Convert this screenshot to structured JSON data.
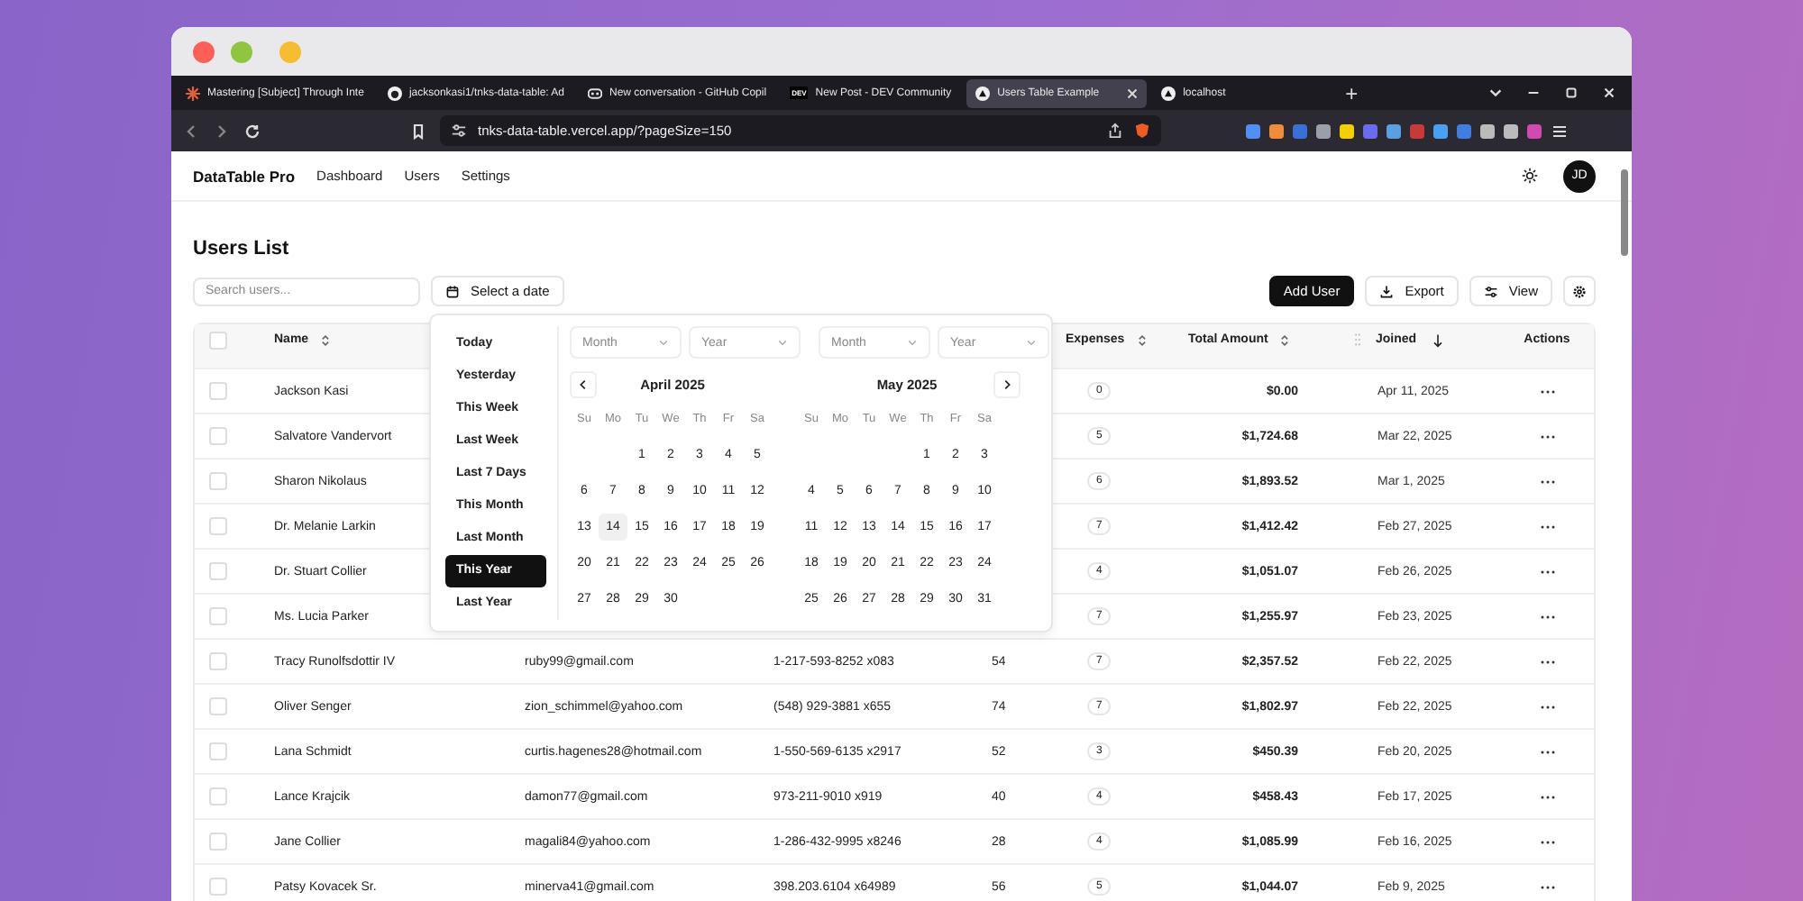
{
  "browser": {
    "tabs": [
      {
        "title": "Mastering [Subject] Through Inte",
        "selected": false,
        "kind": "spark"
      },
      {
        "title": "jacksonkasi1/tnks-data-table: Ad",
        "selected": false,
        "kind": "github"
      },
      {
        "title": "New conversation - GitHub Copil",
        "selected": false,
        "kind": "copilot"
      },
      {
        "title": "New Post - DEV Community",
        "selected": false,
        "kind": "dev"
      },
      {
        "title": "Users Table Example",
        "selected": true,
        "kind": "triangle"
      },
      {
        "title": "localhost",
        "selected": false,
        "kind": "triangle"
      }
    ],
    "new_tab": "+",
    "dev_label": "DEV",
    "address": "tnks-data-table.vercel.app/?pageSize=150"
  },
  "nav": {
    "brand": "DataTable Pro",
    "links": [
      "Dashboard",
      "Users",
      "Settings"
    ],
    "avatar": "JD"
  },
  "page_title": "Users List",
  "toolbar": {
    "search": {
      "placeholder": "Search users..."
    },
    "date_button": "Select a date",
    "add_button": "Add User",
    "export_button": "Export",
    "view_button": "View"
  },
  "date_picker": {
    "presets": [
      {
        "label": "Today",
        "selected": false
      },
      {
        "label": "Yesterday",
        "selected": false
      },
      {
        "label": "This Week",
        "selected": false
      },
      {
        "label": "Last Week",
        "selected": false
      },
      {
        "label": "Last 7 Days",
        "selected": false
      },
      {
        "label": "This Month",
        "selected": false
      },
      {
        "label": "Last Month",
        "selected": false
      },
      {
        "label": "This Year",
        "selected": true
      },
      {
        "label": "Last Year",
        "selected": false
      }
    ],
    "selects": [
      {
        "placeholder": "Month"
      },
      {
        "placeholder": "Year"
      },
      {
        "placeholder": "Month"
      },
      {
        "placeholder": "Year"
      }
    ],
    "calendars": [
      {
        "title": "April 2025",
        "weekdays": [
          "Su",
          "Mo",
          "Tu",
          "We",
          "Th",
          "Fr",
          "Sa"
        ],
        "weeks": [
          [
            {
              "day": "1",
              "today": false
            },
            {
              "day": "2",
              "today": false
            },
            {
              "day": "3",
              "today": false
            },
            {
              "day": "4",
              "today": false
            },
            {
              "day": "5",
              "today": false
            }
          ],
          [
            {
              "day": "6",
              "today": false
            },
            {
              "day": "7",
              "today": false
            },
            {
              "day": "8",
              "today": false
            },
            {
              "day": "9",
              "today": false
            },
            {
              "day": "10",
              "today": false
            },
            {
              "day": "11",
              "today": false
            },
            {
              "day": "12",
              "today": false
            }
          ],
          [
            {
              "day": "13",
              "today": false
            },
            {
              "day": "14",
              "today": true
            },
            {
              "day": "15",
              "today": false
            },
            {
              "day": "16",
              "today": false
            },
            {
              "day": "17",
              "today": false
            },
            {
              "day": "18",
              "today": false
            },
            {
              "day": "19",
              "today": false
            }
          ],
          [
            {
              "day": "20",
              "today": false
            },
            {
              "day": "21",
              "today": false
            },
            {
              "day": "22",
              "today": false
            },
            {
              "day": "23",
              "today": false
            },
            {
              "day": "24",
              "today": false
            },
            {
              "day": "25",
              "today": false
            },
            {
              "day": "26",
              "today": false
            }
          ],
          [
            {
              "day": "27",
              "today": false
            },
            {
              "day": "28",
              "today": false
            },
            {
              "day": "29",
              "today": false
            },
            {
              "day": "30",
              "today": false
            }
          ]
        ]
      },
      {
        "title": "May 2025",
        "weekdays": [
          "Su",
          "Mo",
          "Tu",
          "We",
          "Th",
          "Fr",
          "Sa"
        ],
        "weeks": [
          [
            {
              "day": "1",
              "today": false
            },
            {
              "day": "2",
              "today": false
            },
            {
              "day": "3",
              "today": false
            }
          ],
          [
            {
              "day": "4",
              "today": false
            },
            {
              "day": "5",
              "today": false
            },
            {
              "day": "6",
              "today": false
            },
            {
              "day": "7",
              "today": false
            },
            {
              "day": "8",
              "today": false
            },
            {
              "day": "9",
              "today": false
            },
            {
              "day": "10",
              "today": false
            }
          ],
          [
            {
              "day": "11",
              "today": false
            },
            {
              "day": "12",
              "today": false
            },
            {
              "day": "13",
              "today": false
            },
            {
              "day": "14",
              "today": false
            },
            {
              "day": "15",
              "today": false
            },
            {
              "day": "16",
              "today": false
            },
            {
              "day": "17",
              "today": false
            }
          ],
          [
            {
              "day": "18",
              "today": false
            },
            {
              "day": "19",
              "today": false
            },
            {
              "day": "20",
              "today": false
            },
            {
              "day": "21",
              "today": false
            },
            {
              "day": "22",
              "today": false
            },
            {
              "day": "23",
              "today": false
            },
            {
              "day": "24",
              "today": false
            }
          ],
          [
            {
              "day": "25",
              "today": false
            },
            {
              "day": "26",
              "today": false
            },
            {
              "day": "27",
              "today": false
            },
            {
              "day": "28",
              "today": false
            },
            {
              "day": "29",
              "today": false
            },
            {
              "day": "30",
              "today": false
            },
            {
              "day": "31",
              "today": false
            }
          ]
        ]
      }
    ]
  },
  "table": {
    "header_checked": false,
    "columns": [
      {
        "label": "Name",
        "kind": "sortable"
      },
      {
        "label": "Expenses",
        "kind": "sortable"
      },
      {
        "label": "Total Amount",
        "kind": "sortable"
      },
      {
        "label": "Joined",
        "kind": "sorted"
      },
      {
        "label": "Actions",
        "kind": "plain"
      }
    ],
    "rows": [
      {
        "checked": false,
        "name": "Jackson Kasi",
        "expenses": "0",
        "total": "$0.00",
        "joined": "Apr 11, 2025"
      },
      {
        "checked": false,
        "name": "Salvatore Vandervort",
        "expenses": "5",
        "total": "$1,724.68",
        "joined": "Mar 22, 2025"
      },
      {
        "checked": false,
        "name": "Sharon Nikolaus",
        "expenses": "6",
        "total": "$1,893.52",
        "joined": "Mar 1, 2025"
      },
      {
        "checked": false,
        "name": "Dr. Melanie Larkin",
        "expenses": "7",
        "total": "$1,412.42",
        "joined": "Feb 27, 2025"
      },
      {
        "checked": false,
        "name": "Dr. Stuart Collier",
        "expenses": "4",
        "total": "$1,051.07",
        "joined": "Feb 26, 2025"
      },
      {
        "checked": false,
        "name": "Ms. Lucia Parker",
        "expenses": "7",
        "total": "$1,255.97",
        "joined": "Feb 23, 2025"
      },
      {
        "checked": false,
        "name": "Tracy Runolfsdottir IV",
        "email": "ruby99@gmail.com",
        "phone": "1-217-593-8252 x083",
        "age": "54",
        "expenses": "7",
        "total": "$2,357.52",
        "joined": "Feb 22, 2025"
      },
      {
        "checked": false,
        "name": "Oliver Senger",
        "email": "zion_schimmel@yahoo.com",
        "phone": "(548) 929-3881 x655",
        "age": "74",
        "expenses": "7",
        "total": "$1,802.97",
        "joined": "Feb 22, 2025"
      },
      {
        "checked": false,
        "name": "Lana Schmidt",
        "email": "curtis.hagenes28@hotmail.com",
        "phone": "1-550-569-6135 x2917",
        "age": "52",
        "expenses": "3",
        "total": "$450.39",
        "joined": "Feb 20, 2025"
      },
      {
        "checked": false,
        "name": "Lance Krajcik",
        "email": "damon77@gmail.com",
        "phone": "973-211-9010 x919",
        "age": "40",
        "expenses": "4",
        "total": "$458.43",
        "joined": "Feb 17, 2025"
      },
      {
        "checked": false,
        "name": "Jane Collier",
        "email": "magali84@yahoo.com",
        "phone": "1-286-432-9995 x8246",
        "age": "28",
        "expenses": "4",
        "total": "$1,085.99",
        "joined": "Feb 16, 2025"
      },
      {
        "checked": false,
        "name": "Patsy Kovacek Sr.",
        "email": "minerva41@gmail.com",
        "phone": "398.203.6104 x64989",
        "age": "56",
        "expenses": "5",
        "total": "$1,044.07",
        "joined": "Feb 9, 2025"
      }
    ]
  }
}
